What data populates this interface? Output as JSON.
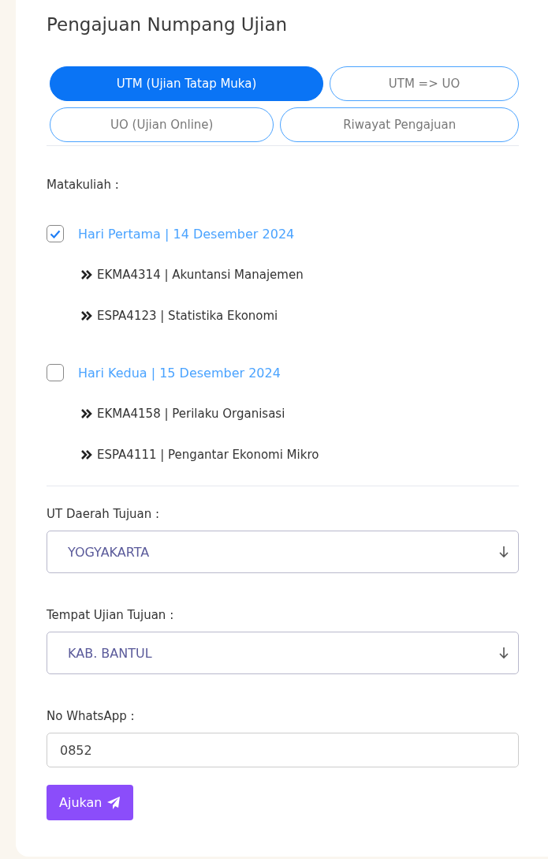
{
  "title": "Pengajuan Numpang Ujian",
  "tab_rows": [
    [
      {
        "label": "UTM (Ujian Tatap Muka)",
        "selected": true
      },
      {
        "label": "UTM => UO",
        "selected": false
      }
    ],
    [
      {
        "label": "UO (Ujian Online)",
        "selected": false
      },
      {
        "label": "Riwayat Pengajuan",
        "selected": false
      }
    ]
  ],
  "courses_label": "Matakuliah :",
  "days": [
    {
      "label": "Hari Pertama | 14 Desember 2024",
      "checked": true,
      "courses": [
        "EKMA4314 | Akuntansi Manajemen",
        "ESPA4123 | Statistika Ekonomi"
      ]
    },
    {
      "label": "Hari Kedua | 15 Desember 2024",
      "checked": false,
      "courses": [
        "EKMA4158 | Perilaku Organisasi",
        "ESPA4111 | Pengantar Ekonomi Mikro"
      ]
    }
  ],
  "region": {
    "label": "UT Daerah Tujuan :",
    "value": "YOGYAKARTA"
  },
  "location": {
    "label": "Tempat Ujian Tujuan :",
    "value": "KAB. BANTUL"
  },
  "whatsapp": {
    "label": "No WhatsApp :",
    "value": "0852"
  },
  "submit": "Ajukan"
}
